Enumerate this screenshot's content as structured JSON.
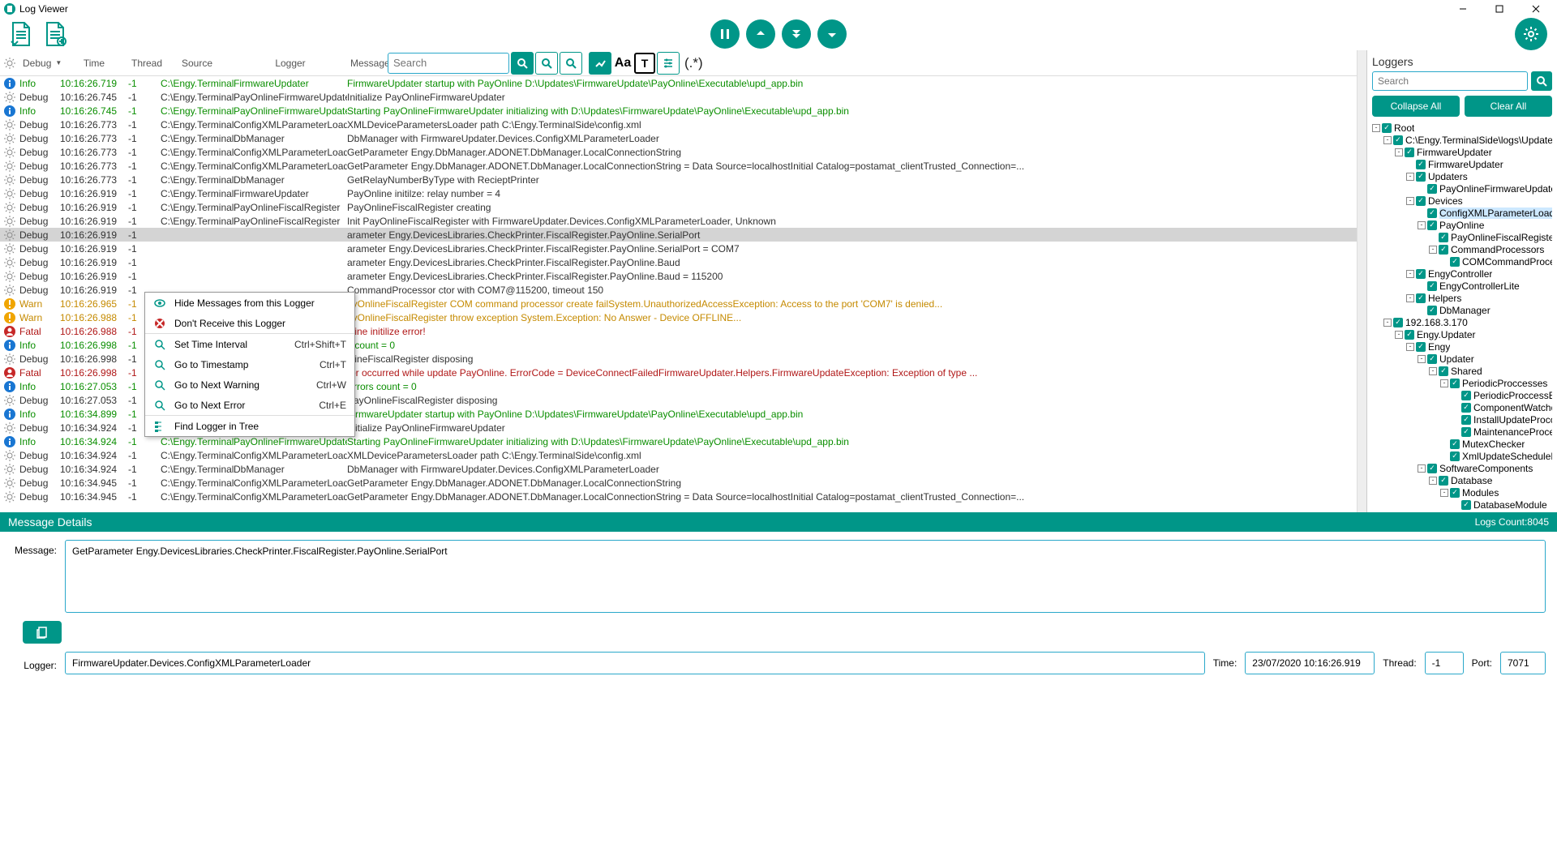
{
  "window": {
    "title": "Log Viewer"
  },
  "toolbar": {
    "regex": "(.*)"
  },
  "headers": {
    "level": "Debug",
    "time": "Time",
    "thread": "Thread",
    "source": "Source",
    "logger": "Logger",
    "message": "Message",
    "search_placeholder": "Search"
  },
  "context_menu": [
    {
      "icon": "eye-off",
      "label": "Hide Messages from this Logger",
      "shortcut": ""
    },
    {
      "icon": "block",
      "label": "Don't Receive this Logger",
      "shortcut": ""
    },
    {
      "sep": true
    },
    {
      "icon": "magnifier",
      "label": "Set Time Interval",
      "shortcut": "Ctrl+Shift+T"
    },
    {
      "icon": "magnifier",
      "label": "Go to Timestamp",
      "shortcut": "Ctrl+T"
    },
    {
      "icon": "magnifier",
      "label": "Go to Next Warning",
      "shortcut": "Ctrl+W"
    },
    {
      "icon": "magnifier",
      "label": "Go to Next Error",
      "shortcut": "Ctrl+E"
    },
    {
      "sep": true
    },
    {
      "icon": "tree",
      "label": "Find Logger in Tree",
      "shortcut": ""
    }
  ],
  "logs": [
    {
      "level": "Info",
      "time": "10:16:26.719",
      "thread": "-1",
      "source": "C:\\Engy.TerminalS",
      "logger": "FirmwareUpdater",
      "msg": "FirmwareUpdater startup with PayOnline D:\\Updates\\FirmwareUpdate\\PayOnline\\Executable\\upd_app.bin"
    },
    {
      "level": "Debug",
      "time": "10:16:26.745",
      "thread": "-1",
      "source": "C:\\Engy.TerminalS",
      "logger": "PayOnlineFirmwareUpdater",
      "msg": "Initialize PayOnlineFirmwareUpdater"
    },
    {
      "level": "Info",
      "time": "10:16:26.745",
      "thread": "-1",
      "source": "C:\\Engy.TerminalS",
      "logger": "PayOnlineFirmwareUpdater",
      "msg": "Starting PayOnlineFirmwareUpdater initializing with D:\\Updates\\FirmwareUpdate\\PayOnline\\Executable\\upd_app.bin"
    },
    {
      "level": "Debug",
      "time": "10:16:26.773",
      "thread": "-1",
      "source": "C:\\Engy.TerminalS",
      "logger": "ConfigXMLParameterLoader",
      "msg": "XMLDeviceParametersLoader path C:\\Engy.TerminalSide\\config.xml"
    },
    {
      "level": "Debug",
      "time": "10:16:26.773",
      "thread": "-1",
      "source": "C:\\Engy.TerminalS",
      "logger": "DbManager",
      "msg": "DbManager with FirmwareUpdater.Devices.ConfigXMLParameterLoader"
    },
    {
      "level": "Debug",
      "time": "10:16:26.773",
      "thread": "-1",
      "source": "C:\\Engy.TerminalS",
      "logger": "ConfigXMLParameterLoader",
      "msg": "GetParameter Engy.DbManager.ADONET.DbManager.LocalConnectionString"
    },
    {
      "level": "Debug",
      "time": "10:16:26.773",
      "thread": "-1",
      "source": "C:\\Engy.TerminalS",
      "logger": "ConfigXMLParameterLoader",
      "msg": "GetParameter Engy.DbManager.ADONET.DbManager.LocalConnectionString = Data Source=localhostInitial Catalog=postamat_clientTrusted_Connection=..."
    },
    {
      "level": "Debug",
      "time": "10:16:26.773",
      "thread": "-1",
      "source": "C:\\Engy.TerminalS",
      "logger": "DbManager",
      "msg": "GetRelayNumberByType with RecieptPrinter"
    },
    {
      "level": "Debug",
      "time": "10:16:26.919",
      "thread": "-1",
      "source": "C:\\Engy.TerminalS",
      "logger": "FirmwareUpdater",
      "msg": "PayOnline initilze: relay number = 4"
    },
    {
      "level": "Debug",
      "time": "10:16:26.919",
      "thread": "-1",
      "source": "C:\\Engy.TerminalS",
      "logger": "PayOnlineFiscalRegister",
      "msg": "PayOnlineFiscalRegister creating"
    },
    {
      "level": "Debug",
      "time": "10:16:26.919",
      "thread": "-1",
      "source": "C:\\Engy.TerminalS",
      "logger": "PayOnlineFiscalRegister",
      "msg": "Init PayOnlineFiscalRegister with FirmwareUpdater.Devices.ConfigXMLParameterLoader, Unknown"
    },
    {
      "level": "Debug",
      "time": "10:16:26.919",
      "thread": "-1",
      "source": "",
      "logger": "",
      "msg": "arameter Engy.DevicesLibraries.CheckPrinter.FiscalRegister.PayOnline.SerialPort",
      "sel": true
    },
    {
      "level": "Debug",
      "time": "10:16:26.919",
      "thread": "-1",
      "source": "",
      "logger": "",
      "msg": "arameter Engy.DevicesLibraries.CheckPrinter.FiscalRegister.PayOnline.SerialPort = COM7"
    },
    {
      "level": "Debug",
      "time": "10:16:26.919",
      "thread": "-1",
      "source": "",
      "logger": "",
      "msg": "arameter Engy.DevicesLibraries.CheckPrinter.FiscalRegister.PayOnline.Baud"
    },
    {
      "level": "Debug",
      "time": "10:16:26.919",
      "thread": "-1",
      "source": "",
      "logger": "",
      "msg": "arameter Engy.DevicesLibraries.CheckPrinter.FiscalRegister.PayOnline.Baud = 115200"
    },
    {
      "level": "Debug",
      "time": "10:16:26.919",
      "thread": "-1",
      "source": "",
      "logger": "",
      "msg": "CommandProcessor ctor with COM7@115200, timeout 150"
    },
    {
      "level": "Warn",
      "time": "10:16:26.965",
      "thread": "-1",
      "source": "",
      "logger": "",
      "msg": "ayOnlineFiscalRegister COM command processor create failSystem.UnauthorizedAccessException: Access to the port 'COM7' is denied..."
    },
    {
      "level": "Warn",
      "time": "10:16:26.988",
      "thread": "-1",
      "source": "",
      "logger": "",
      "msg": "ayOnlineFiscalRegister throw exception System.Exception: No Answer - Device OFFLINE..."
    },
    {
      "level": "Fatal",
      "time": "10:16:26.988",
      "thread": "-1",
      "source": "",
      "logger": "",
      "msg": "nline initilize error!"
    },
    {
      "level": "Info",
      "time": "10:16:26.998",
      "thread": "-1",
      "source": "",
      "logger": "",
      "msg": "s count = 0"
    },
    {
      "level": "Debug",
      "time": "10:16:26.998",
      "thread": "-1",
      "source": "",
      "logger": "",
      "msg": "nlineFiscalRegister disposing"
    },
    {
      "level": "Fatal",
      "time": "10:16:26.998",
      "thread": "-1",
      "source": "",
      "logger": "",
      "msg": "ror occurred while update PayOnline. ErrorCode = DeviceConnectFailedFirmwareUpdater.Helpers.FirmwareUpdateException: Exception of type ..."
    },
    {
      "level": "Info",
      "time": "10:16:27.053",
      "thread": "-1",
      "source": "C:\\Engy.TerminalS",
      "logger": "PayOnlineFiscalRegister",
      "msg": "Errors count = 0"
    },
    {
      "level": "Debug",
      "time": "10:16:27.053",
      "thread": "-1",
      "source": "C:\\Engy.TerminalS",
      "logger": "PayOnlineFiscalRegister",
      "msg": "PayOnlineFiscalRegister disposing"
    },
    {
      "level": "Info",
      "time": "10:16:34.899",
      "thread": "-1",
      "source": "C:\\Engy.TerminalS",
      "logger": "FirmwareUpdater",
      "msg": "FirmwareUpdater startup with PayOnline D:\\Updates\\FirmwareUpdate\\PayOnline\\Executable\\upd_app.bin"
    },
    {
      "level": "Debug",
      "time": "10:16:34.924",
      "thread": "-1",
      "source": "C:\\Engy.TerminalS",
      "logger": "PayOnlineFirmwareUpdater",
      "msg": "Initialize PayOnlineFirmwareUpdater"
    },
    {
      "level": "Info",
      "time": "10:16:34.924",
      "thread": "-1",
      "source": "C:\\Engy.TerminalS",
      "logger": "PayOnlineFirmwareUpdater",
      "msg": "Starting PayOnlineFirmwareUpdater initializing with D:\\Updates\\FirmwareUpdate\\PayOnline\\Executable\\upd_app.bin"
    },
    {
      "level": "Debug",
      "time": "10:16:34.924",
      "thread": "-1",
      "source": "C:\\Engy.TerminalS",
      "logger": "ConfigXMLParameterLoader",
      "msg": "XMLDeviceParametersLoader path C:\\Engy.TerminalSide\\config.xml"
    },
    {
      "level": "Debug",
      "time": "10:16:34.924",
      "thread": "-1",
      "source": "C:\\Engy.TerminalS",
      "logger": "DbManager",
      "msg": "DbManager with FirmwareUpdater.Devices.ConfigXMLParameterLoader"
    },
    {
      "level": "Debug",
      "time": "10:16:34.945",
      "thread": "-1",
      "source": "C:\\Engy.TerminalS",
      "logger": "ConfigXMLParameterLoader",
      "msg": "GetParameter Engy.DbManager.ADONET.DbManager.LocalConnectionString"
    },
    {
      "level": "Debug",
      "time": "10:16:34.945",
      "thread": "-1",
      "source": "C:\\Engy.TerminalS",
      "logger": "ConfigXMLParameterLoader",
      "msg": "GetParameter Engy.DbManager.ADONET.DbManager.LocalConnectionString = Data Source=localhostInitial Catalog=postamat_clientTrusted_Connection=..."
    }
  ],
  "side": {
    "title": "Loggers",
    "search_placeholder": "Search",
    "collapse": "Collapse All",
    "clear": "Clear All",
    "tree": [
      {
        "d": 0,
        "exp": "-",
        "label": "Root"
      },
      {
        "d": 1,
        "exp": "-",
        "label": "C:\\Engy.TerminalSide\\logs\\Updater\\Firmware"
      },
      {
        "d": 2,
        "exp": "-",
        "label": "FirmwareUpdater"
      },
      {
        "d": 3,
        "exp": "",
        "label": "FirmwareUpdater"
      },
      {
        "d": 3,
        "exp": "-",
        "label": "Updaters"
      },
      {
        "d": 4,
        "exp": "",
        "label": "PayOnlineFirmwareUpdater"
      },
      {
        "d": 3,
        "exp": "-",
        "label": "Devices"
      },
      {
        "d": 4,
        "exp": "",
        "label": "ConfigXMLParameterLoader",
        "sel": true
      },
      {
        "d": 4,
        "exp": "-",
        "label": "PayOnline"
      },
      {
        "d": 5,
        "exp": "",
        "label": "PayOnlineFiscalRegister"
      },
      {
        "d": 5,
        "exp": "-",
        "label": "CommandProcessors"
      },
      {
        "d": 6,
        "exp": "",
        "label": "COMCommandProcessor"
      },
      {
        "d": 3,
        "exp": "-",
        "label": "EngyController"
      },
      {
        "d": 4,
        "exp": "",
        "label": "EngyControllerLite"
      },
      {
        "d": 3,
        "exp": "-",
        "label": "Helpers"
      },
      {
        "d": 4,
        "exp": "",
        "label": "DbManager"
      },
      {
        "d": 1,
        "exp": "-",
        "label": "192.168.3.170"
      },
      {
        "d": 2,
        "exp": "-",
        "label": "Engy.Updater"
      },
      {
        "d": 3,
        "exp": "-",
        "label": "Engy"
      },
      {
        "d": 4,
        "exp": "-",
        "label": "Updater"
      },
      {
        "d": 5,
        "exp": "-",
        "label": "Shared"
      },
      {
        "d": 6,
        "exp": "-",
        "label": "PeriodicProccesses"
      },
      {
        "d": 7,
        "exp": "",
        "label": "PeriodicProccessBase"
      },
      {
        "d": 7,
        "exp": "",
        "label": "ComponentWatchdogPr"
      },
      {
        "d": 7,
        "exp": "",
        "label": "InstallUpdateProccess"
      },
      {
        "d": 7,
        "exp": "",
        "label": "MaintenanceProcess"
      },
      {
        "d": 6,
        "exp": "",
        "label": "MutexChecker"
      },
      {
        "d": 6,
        "exp": "",
        "label": "XmlUpdateScheduleManag"
      },
      {
        "d": 4,
        "exp": "-",
        "label": "SoftwareComponents"
      },
      {
        "d": 5,
        "exp": "-",
        "label": "Database"
      },
      {
        "d": 6,
        "exp": "-",
        "label": "Modules"
      },
      {
        "d": 7,
        "exp": "",
        "label": "DatabaseModule"
      }
    ]
  },
  "details": {
    "title": "Message Details",
    "logs_count_label": "Logs Count: ",
    "logs_count": "8045",
    "msg_label": "Message:",
    "msg": "GetParameter Engy.DevicesLibraries.CheckPrinter.FiscalRegister.PayOnline.SerialPort",
    "logger_label": "Logger:",
    "logger": "FirmwareUpdater.Devices.ConfigXMLParameterLoader",
    "time_label": "Time:",
    "time": "23/07/2020 10:16:26.919",
    "thread_label": "Thread:",
    "thread": "-1",
    "port_label": "Port:",
    "port": "7071"
  }
}
